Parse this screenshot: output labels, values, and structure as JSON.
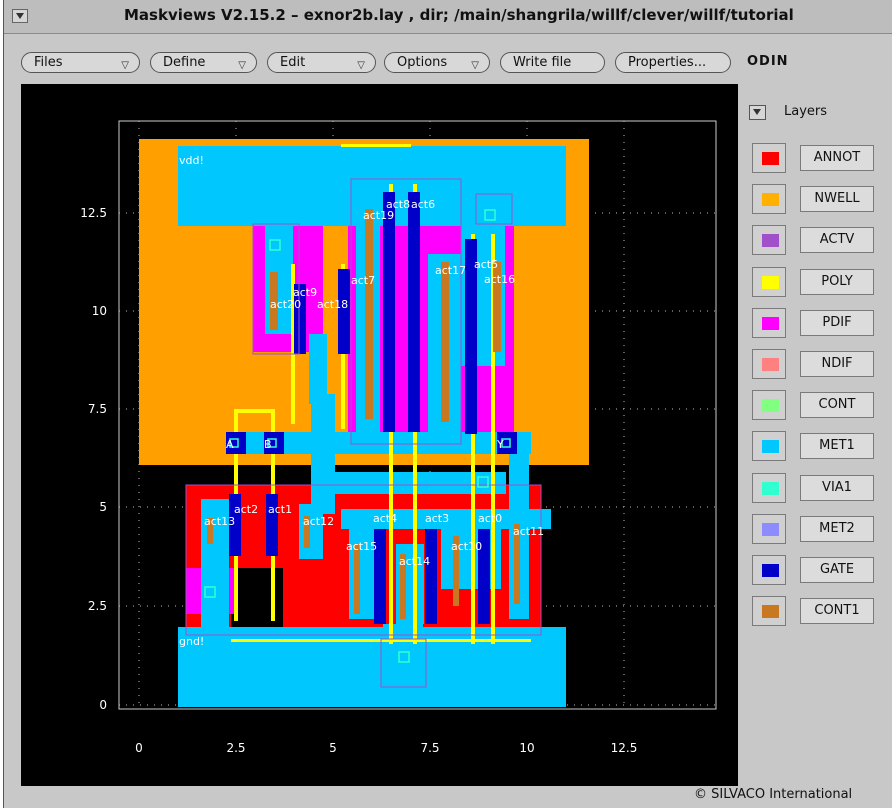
{
  "window": {
    "title": "Maskviews V2.15.2 – exnor2b.lay , dir; /main/shangrila/willf/clever/willf/tutorial"
  },
  "menubar": {
    "files": "Files",
    "define": "Define",
    "edit": "Edit",
    "options": "Options",
    "write_file": "Write file",
    "properties": "Properties...",
    "app_label": "ODIN"
  },
  "icons": {
    "system_menu": "triangle-down-icon",
    "dropdown": "triangle-down-icon"
  },
  "layers_panel": {
    "title": "Layers",
    "layers": [
      {
        "name": "ANNOT",
        "color": "#ff0000"
      },
      {
        "name": "NWELL",
        "color": "#ffb000"
      },
      {
        "name": "ACTV",
        "color": "#a050c8"
      },
      {
        "name": "POLY",
        "color": "#ffff00"
      },
      {
        "name": "PDIF",
        "color": "#ff00ff"
      },
      {
        "name": "NDIF",
        "color": "#ff8080"
      },
      {
        "name": "CONT",
        "color": "#80ff80"
      },
      {
        "name": "MET1",
        "color": "#00c8ff"
      },
      {
        "name": "VIA1",
        "color": "#30ffd0"
      },
      {
        "name": "MET2",
        "color": "#8c8cff"
      },
      {
        "name": "GATE",
        "color": "#0000c8"
      },
      {
        "name": "CONT1",
        "color": "#c87820"
      }
    ]
  },
  "layout_view": {
    "x_ticks": [
      "0",
      "2.5",
      "5",
      "7.5",
      "10",
      "12.5"
    ],
    "y_ticks": [
      "12.5",
      "10",
      "7.5",
      "5",
      "2.5",
      "0"
    ],
    "net_labels": {
      "vdd": "vdd!",
      "gnd": "gnd!",
      "a": "A",
      "b": "B",
      "y": "Y"
    },
    "device_labels": [
      "act19",
      "act8",
      "act6",
      "act17",
      "act5",
      "act16",
      "act7",
      "act9",
      "act20",
      "act18",
      "act13",
      "act2",
      "act1",
      "act12",
      "act4",
      "act3",
      "act0",
      "act11",
      "act15",
      "act10",
      "act14"
    ]
  },
  "footer": {
    "copyright": "© SILVACO International"
  }
}
